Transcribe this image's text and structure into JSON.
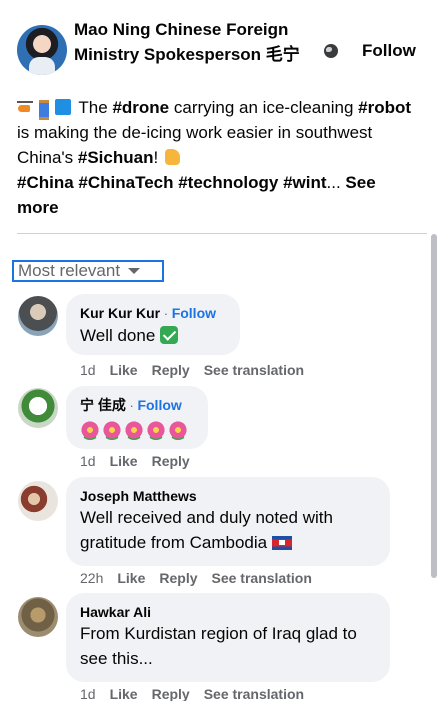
{
  "post": {
    "page_name": "Mao Ning Chinese Foreign Ministry Spokesperson 毛宁",
    "follow_label": "Follow",
    "text_parts": {
      "t1": "The ",
      "h1": "#drone",
      "t2": " carrying an ice-cleaning ",
      "h2": "#robot",
      "t3": " is making the de-icing work easier in southwest China's ",
      "h3": "#Sichuan",
      "t4": "! ",
      "tags": "#China #ChinaTech #technology #wint",
      "ellipsis": "... ",
      "see_more": "See more"
    },
    "icons": [
      "helicopter-icon",
      "thread-spool-icon",
      "blue-cube-icon",
      "thumbs-up-icon",
      "globe-icon"
    ]
  },
  "comments_filter": {
    "label": "Most relevant"
  },
  "comments": [
    {
      "author": "Kur Kur Kur",
      "follow": "Follow",
      "text": "Well done",
      "time": "1d",
      "like": "Like",
      "reply": "Reply",
      "see_translation": "See translation"
    },
    {
      "author": "宁 佳成",
      "follow": "Follow",
      "text": "",
      "time": "1d",
      "like": "Like",
      "reply": "Reply"
    },
    {
      "author": "Joseph Matthews",
      "text": "Well received and duly noted with gratitude from Cambodia",
      "time": "22h",
      "like": "Like",
      "reply": "Reply",
      "see_translation": "See translation"
    },
    {
      "author": "Hawkar Ali",
      "text": "From Kurdistan region of Iraq glad to see this...",
      "time": "1d",
      "like": "Like",
      "reply": "Reply",
      "see_translation": "See translation"
    }
  ],
  "colors": {
    "link_blue": "#1b74e4",
    "bubble_bg": "#f0f2f5",
    "meta_gray": "#65676b"
  }
}
